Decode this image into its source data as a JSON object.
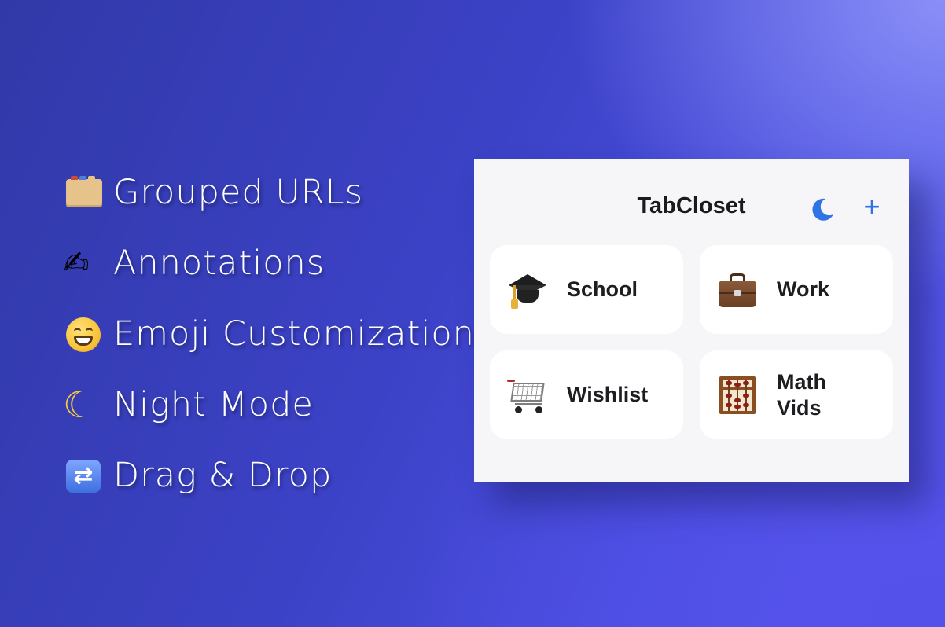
{
  "features": [
    {
      "icon": "card-index-dividers-icon",
      "label": "Grouped URLs"
    },
    {
      "icon": "writing-hand-icon",
      "label": "Annotations"
    },
    {
      "icon": "grinning-face-icon",
      "label": "Emoji Customization"
    },
    {
      "icon": "crescent-moon-icon",
      "label": "Night Mode"
    },
    {
      "icon": "repeat-arrows-icon",
      "label": "Drag & Drop"
    }
  ],
  "popup": {
    "title": "TabCloset",
    "add_label": "+",
    "accent": "#2f74e6",
    "groups": [
      {
        "icon": "graduation-cap-icon",
        "label": "School"
      },
      {
        "icon": "briefcase-icon",
        "label": "Work"
      },
      {
        "icon": "shopping-cart-icon",
        "label": "Wishlist"
      },
      {
        "icon": "abacus-icon",
        "label": "Math Vids"
      }
    ]
  },
  "colors": {
    "background_start": "#3139a8",
    "background_end": "#5a5ef0",
    "popup_background": "#f6f6f9",
    "card_background": "#ffffff"
  }
}
